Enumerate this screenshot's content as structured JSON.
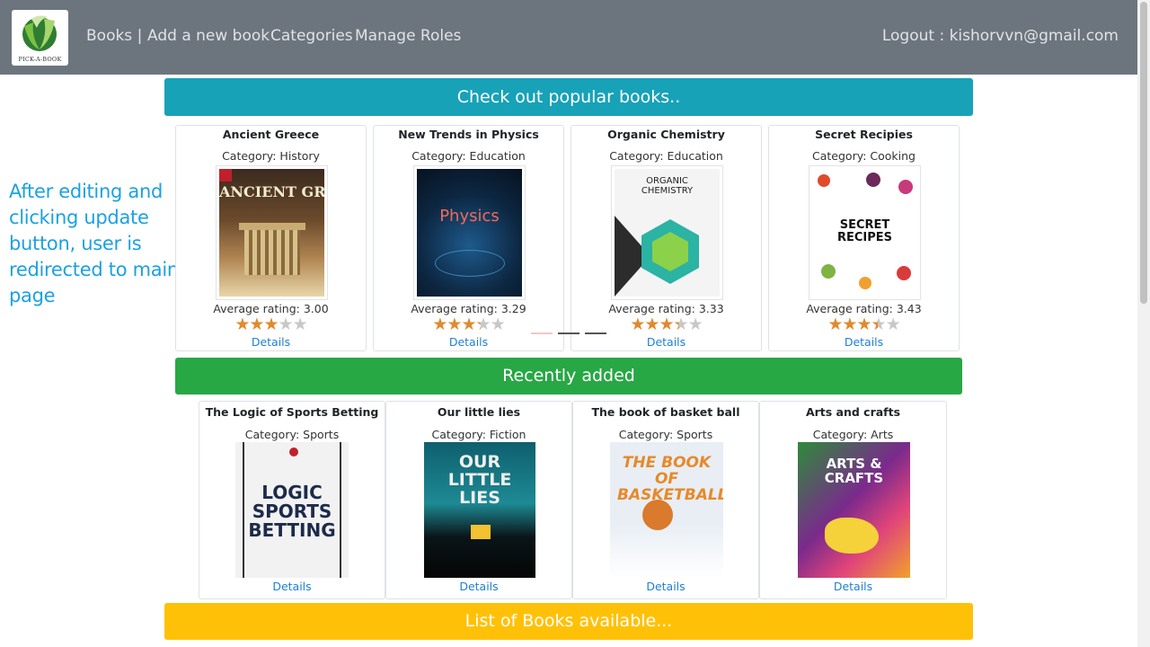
{
  "navbar": {
    "logo_text": "PICK-A-BOOK",
    "links": [
      "Books |",
      "Add a new book",
      "Categories",
      "Manage Roles"
    ],
    "logout": "Logout : kishorvvn@gmail.com"
  },
  "side_note": "After editing and clicking update button, user is redirected to main page",
  "sections": {
    "popular": "Check out popular books..",
    "recent": "Recently added",
    "list": "List of Books available..."
  },
  "popular_books": [
    {
      "title": "Ancient Greece",
      "category": "Category: History",
      "rating_text": "Average rating: 3.00",
      "rating": 3.0,
      "details": "Details",
      "cover_text": "ANCIENT GREECE"
    },
    {
      "title": "New Trends in Physics",
      "category": "Category: Education",
      "rating_text": "Average rating: 3.29",
      "rating": 3.29,
      "details": "Details",
      "cover_text": "Physics"
    },
    {
      "title": "Organic Chemistry",
      "category": "Category: Education",
      "rating_text": "Average rating: 3.33",
      "rating": 3.33,
      "details": "Details",
      "cover_text": "ORGANIC CHEMISTRY"
    },
    {
      "title": "Secret Recipies",
      "category": "Category: Cooking",
      "rating_text": "Average rating: 3.43",
      "rating": 3.43,
      "details": "Details",
      "cover_text": "SECRET RECIPES"
    }
  ],
  "recent_books": [
    {
      "title": "The Logic of Sports Betting",
      "category": "Category: Sports",
      "details": "Details",
      "cover_text": "LOGIC SPORTS BETTING"
    },
    {
      "title": "Our little lies",
      "category": "Category: Fiction",
      "details": "Details",
      "cover_text": "OUR LITTLE LIES"
    },
    {
      "title": "The book of basket ball",
      "category": "Category: Sports",
      "details": "Details",
      "cover_text": "THE BOOK OF BASKETBALL"
    },
    {
      "title": "Arts and crafts",
      "category": "Category: Arts",
      "details": "Details",
      "cover_text": "ARTS & CRAFTS"
    }
  ],
  "carousel": {
    "active_index": 0,
    "count": 3
  },
  "colors": {
    "navbar": "#6c757d",
    "popular_banner": "#17a2b8",
    "recent_banner": "#28a745",
    "list_banner": "#ffc107",
    "side_note": "#1ba1e2",
    "link": "#1e7fd6",
    "star_on": "#e08a2e"
  }
}
